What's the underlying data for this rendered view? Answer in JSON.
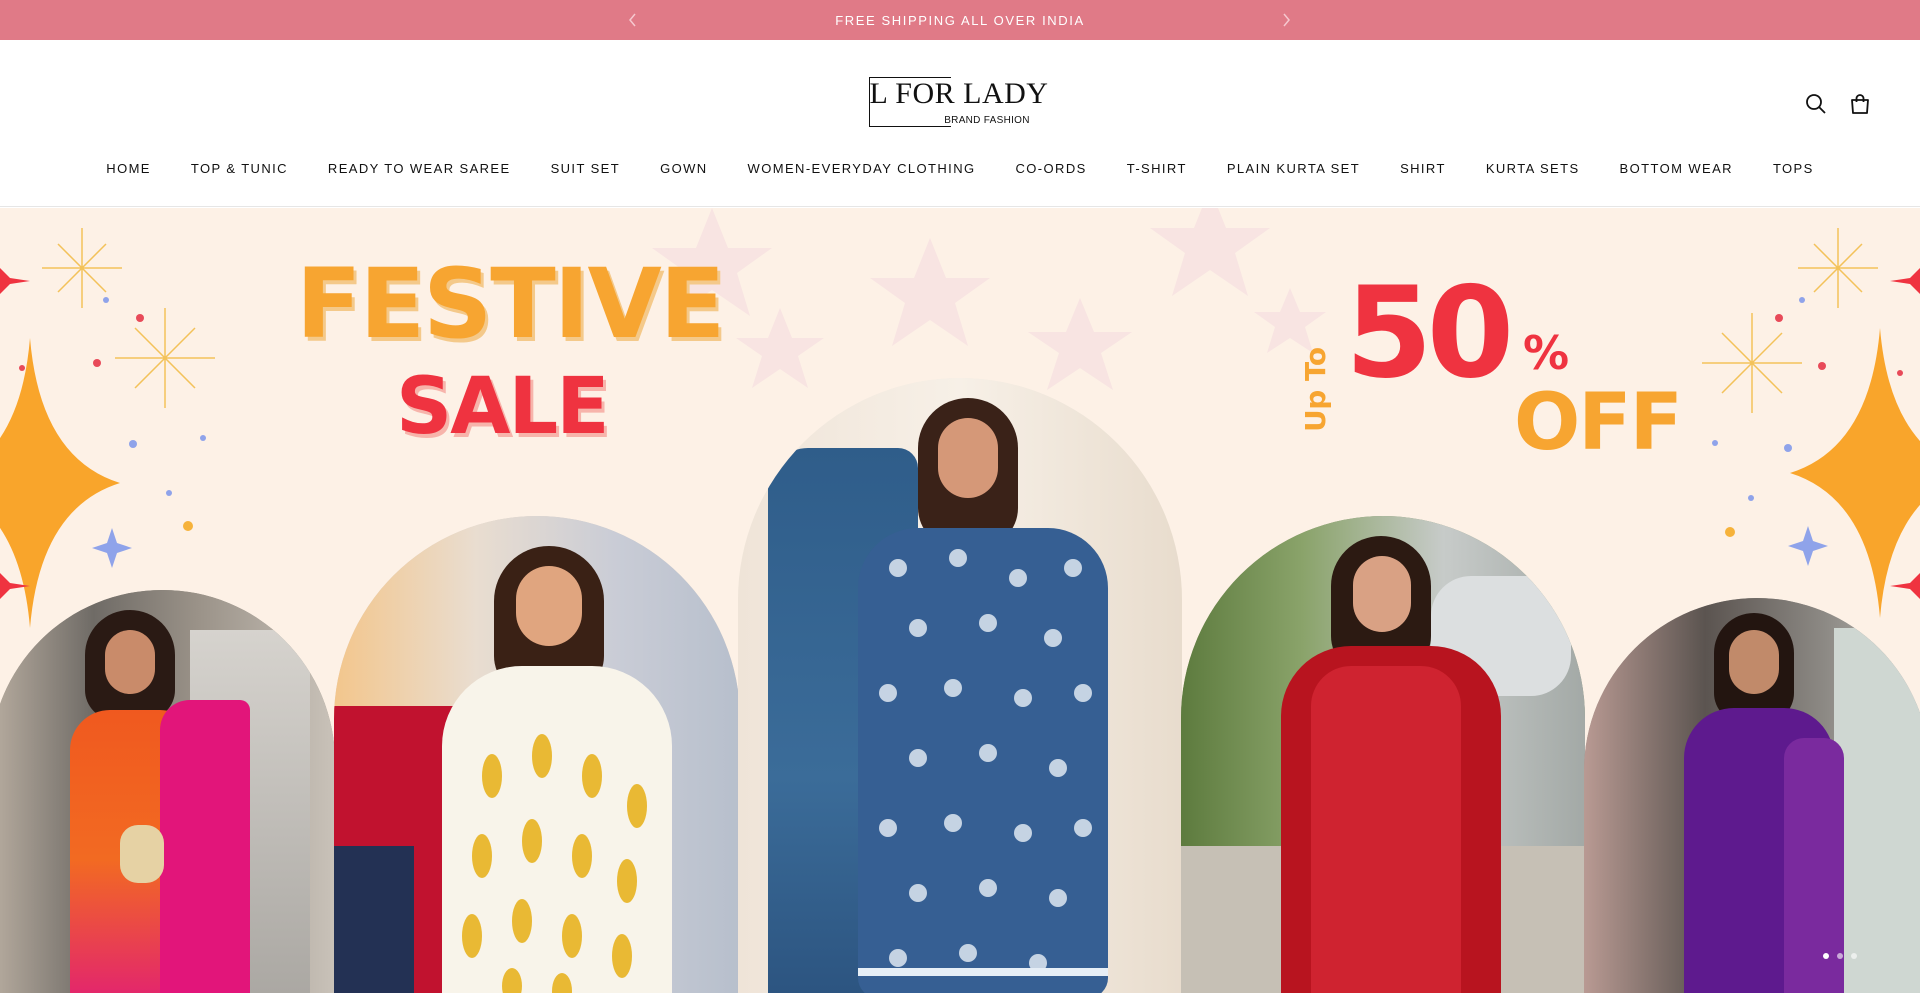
{
  "announcement": {
    "text": "FREE SHIPPING ALL OVER INDIA",
    "prev_icon": "chevron-left-icon",
    "next_icon": "chevron-right-icon"
  },
  "header": {
    "logo_title": "L FOR LADY",
    "logo_subtitle": "BRAND FASHION",
    "search_icon": "search-icon",
    "cart_icon": "shopping-bag-icon"
  },
  "nav": {
    "items": [
      "HOME",
      "TOP & TUNIC",
      "READY TO WEAR SAREE",
      "SUIT SET",
      "GOWN",
      "WOMEN-EVERYDAY CLOTHING",
      "CO-ORDS",
      "T-SHIRT",
      "PLAIN KURTA SET",
      "SHIRT",
      "KURTA SETS",
      "BOTTOM WEAR",
      "TOPS"
    ]
  },
  "hero": {
    "headline_1": "FESTIVE",
    "headline_2": "SALE",
    "offer_prefix": "Up To",
    "offer_value": "50",
    "offer_percent": "%",
    "offer_suffix": "OFF"
  },
  "colors": {
    "announcement_bg": "#e07a87",
    "hero_bg": "#fdf1e6",
    "accent_orange": "#f7a531",
    "accent_red": "#ef3340"
  }
}
